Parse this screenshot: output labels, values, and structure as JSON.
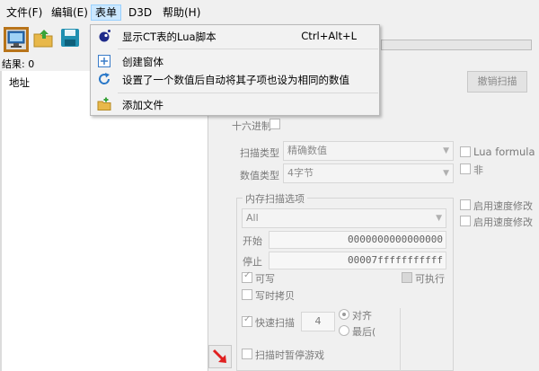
{
  "menubar": {
    "items": [
      "文件(F)",
      "编辑(E)",
      "表单",
      "D3D",
      "帮助(H)"
    ]
  },
  "results_label": "结果: 0",
  "address_header": "地址",
  "dropdown": {
    "items": [
      {
        "label": "显示CT表的Lua脚本",
        "shortcut": "Ctrl+Alt+L"
      },
      {
        "label": "创建窗体"
      },
      {
        "label": "设置了一个数值后自动将其子项也设为相同的数值"
      },
      {
        "label": "添加文件"
      }
    ]
  },
  "scan": {
    "undo_scan_button": "撤销扫描",
    "hex_label": "十六进制",
    "scan_type_label": "扫描类型",
    "scan_type_value": "精确数值",
    "value_type_label": "数值类型",
    "value_type_value": "4字节",
    "memory_options_title": "内存扫描选项",
    "region_value": "All",
    "start_label": "开始",
    "start_value": "0000000000000000",
    "stop_label": "停止",
    "stop_value": "00007fffffffffff",
    "writable_label": "可写",
    "executable_label": "可执行",
    "copy_on_write_label": "写时拷贝",
    "fast_scan_label": "快速扫描",
    "fast_scan_value": "4",
    "align_label": "对齐",
    "last_digits_label": "最后(",
    "pause_game_label": "扫描时暂停游戏"
  },
  "right_options": {
    "lua_formula_label": "Lua formula",
    "not_label": "非",
    "speedhack1_label": "启用速度修改",
    "speedhack2_label": "启用速度修改"
  },
  "colors": {
    "selected_tool_border": "#b8741a",
    "menu_active_bg": "#cce8ff",
    "arrow_red": "#e02020"
  }
}
